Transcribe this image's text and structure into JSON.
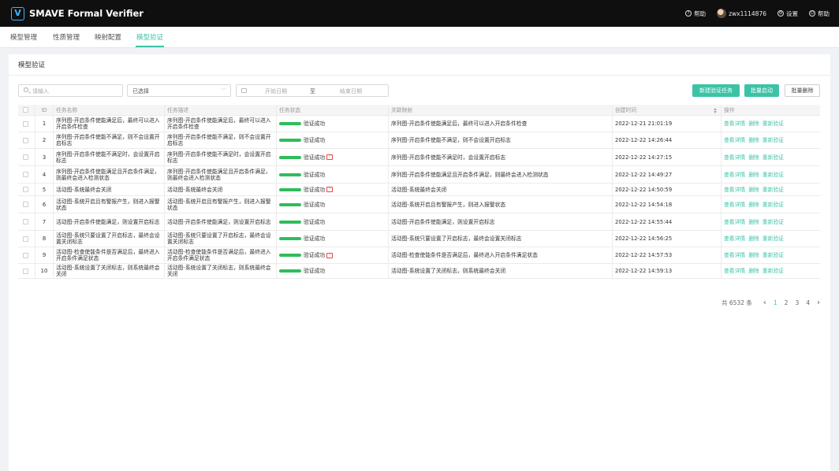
{
  "app": {
    "logo": "V",
    "title": "SMAVE Formal Verifier"
  },
  "topbar": {
    "help1": "帮助",
    "user": "zwx1114876",
    "settings": "设置",
    "help2": "帮助"
  },
  "nav": [
    "模型管理",
    "性质管理",
    "映射配置",
    "模型验证"
  ],
  "panel": {
    "title": "模型验证"
  },
  "filters": {
    "search_placeholder": "请输入",
    "select_value": "已选择",
    "start_placeholder": "开始日期",
    "range_sep": "至",
    "end_placeholder": "结束日期"
  },
  "actions": {
    "create": "新建验证任务",
    "batch_start": "批量启动",
    "batch_delete": "批量删除"
  },
  "table": {
    "headers": [
      "ID",
      "任务名称",
      "任务描述",
      "任务状态",
      "关联映射",
      "创建时间",
      "操作"
    ],
    "ops": [
      "查看详情",
      "删除",
      "重新验证"
    ],
    "rows": [
      {
        "id": "1",
        "name": "序列图-开启条件使能满足后，最终可以进入开启条件检查",
        "desc": "序列图-开启条件使能满足后，最终可以进入开启条件检查",
        "status": "验证成功",
        "warn": false,
        "mapping": "序列图-开启条件使能满足后，最终可以进入开启条件检查",
        "time": "2022-12-21  21:01:19"
      },
      {
        "id": "2",
        "name": "序列图-开启条件使能不满足，则不会设置开启标志",
        "desc": "序列图-开启条件使能不满足，则不会设置开启标志",
        "status": "验证成功",
        "warn": false,
        "mapping": "序列图-开启条件使能不满足，则不会设置开启标志",
        "time": "2022-12-22  14:26:44"
      },
      {
        "id": "3",
        "name": "序列图-开启条件使能不满足时，会设置开启标志",
        "desc": "序列图-开启条件使能不满足时，会设置开启标志",
        "status": "验证成功",
        "warn": true,
        "mapping": "序列图-开启条件使能不满足时，会设置开启标志",
        "time": "2022-12-22  14:27:15"
      },
      {
        "id": "4",
        "name": "序列图-开启条件使能满足且开启条件满足，则最终会进入检测状态",
        "desc": "序列图-开启条件使能满足且开启条件满足，则最终会进入检测状态",
        "status": "验证成功",
        "warn": false,
        "mapping": "序列图-开启条件使能满足且开启条件满足，则最终会进入检测状态",
        "time": "2022-12-22  14:49:27"
      },
      {
        "id": "5",
        "name": "活动图-系统最终会关闭",
        "desc": "活动图-系统最终会关闭",
        "status": "验证成功",
        "warn": true,
        "mapping": "活动图-系统最终会关闭",
        "time": "2022-12-22  14:50:59"
      },
      {
        "id": "6",
        "name": "活动图-系统开启且有警报产生，则进入报警状态",
        "desc": "活动图-系统开启且有警报产生，则进入报警状态",
        "status": "验证成功",
        "warn": false,
        "mapping": "活动图-系统开启且有警报产生，则进入报警状态",
        "time": "2022-12-22  14:54:18"
      },
      {
        "id": "7",
        "name": "活动图-开启条件使能满足，则设置开启标志",
        "desc": "活动图-开启条件使能满足，则设置开启标志",
        "status": "验证成功",
        "warn": false,
        "mapping": "活动图-开启条件使能满足，则设置开启标志",
        "time": "2022-12-22  14:55:44"
      },
      {
        "id": "8",
        "name": "活动图-系统只要设置了开启标志，最终会设置关闭标志",
        "desc": "活动图-系统只要设置了开启标志，最终会设置关闭标志",
        "status": "验证成功",
        "warn": false,
        "mapping": "活动图-系统只要设置了开启标志，最终会设置关闭标志",
        "time": "2022-12-22  14:56:25"
      },
      {
        "id": "9",
        "name": "活动图-检查使能条件是否满足后，最终进入开启条件满足状态",
        "desc": "活动图-检查使能条件是否满足后，最终进入开启条件满足状态",
        "status": "验证成功",
        "warn": true,
        "mapping": "活动图-检查使能条件是否满足后，最终进入开启条件满足状态",
        "time": "2022-12-22  14:57:53"
      },
      {
        "id": "10",
        "name": "活动图-系统设置了关闭标志，则系统最终会关闭",
        "desc": "活动图-系统设置了关闭标志，则系统最终会关闭",
        "status": "验证成功",
        "warn": false,
        "mapping": "活动图-系统设置了关闭标志，则系统最终会关闭",
        "time": "2022-12-22  14:59:13"
      }
    ]
  },
  "pagination": {
    "total": "共 6532 条",
    "prev": "‹",
    "pages": [
      "1",
      "2",
      "3",
      "4"
    ],
    "next": "›"
  },
  "colors": {
    "accent": "#3cc3a6",
    "success": "#2ebd5b",
    "warn": "#e04848"
  }
}
